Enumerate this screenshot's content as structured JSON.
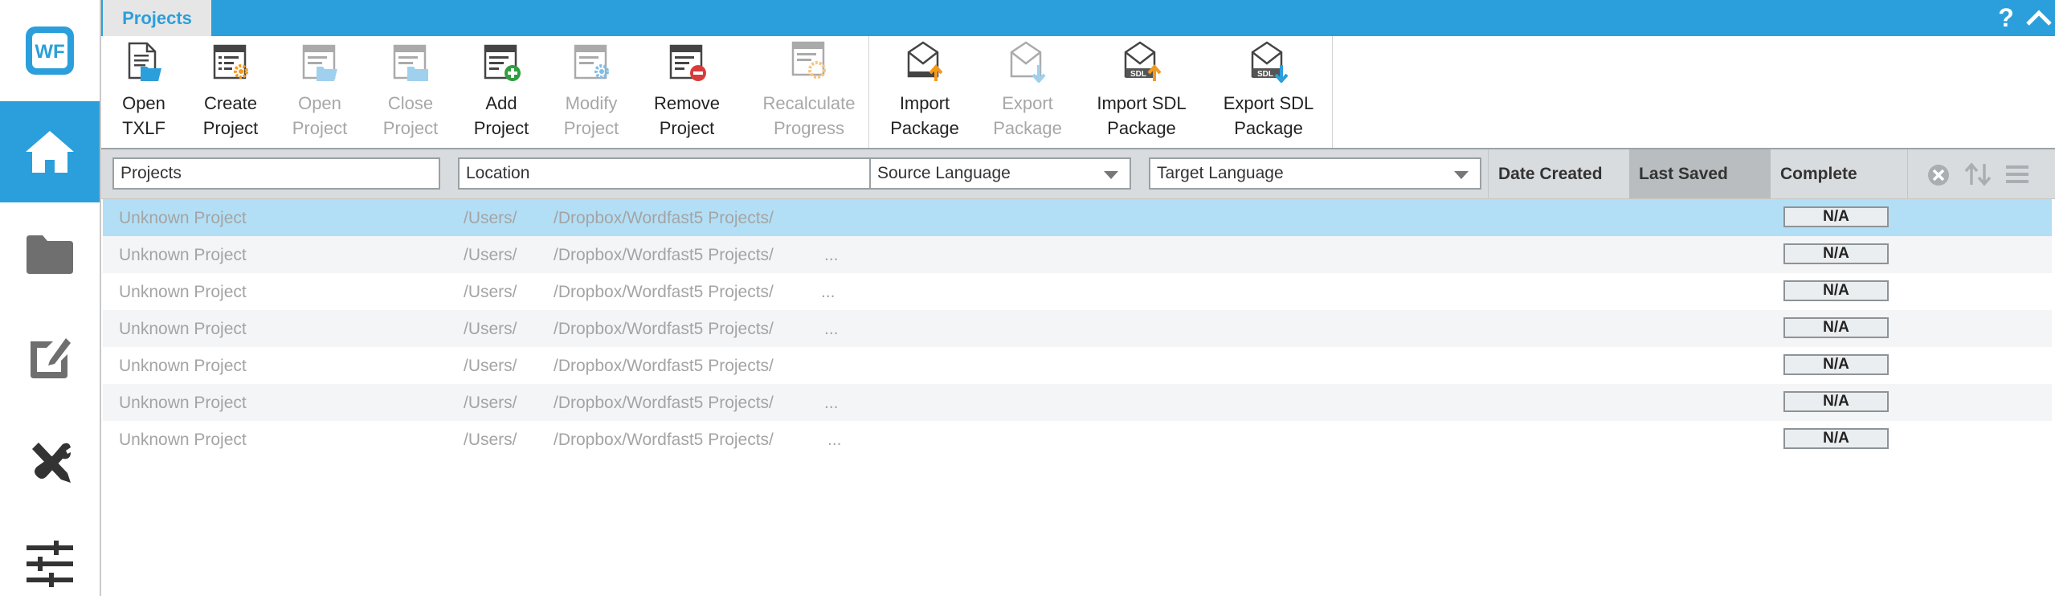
{
  "app": {
    "tab_label": "Projects",
    "help_label": "?",
    "accent_color": "#2b9fdb"
  },
  "sidebar": {
    "items": [
      {
        "name": "wf-logo",
        "label": "WF"
      },
      {
        "name": "home-icon",
        "active": true
      },
      {
        "name": "folder-icon"
      },
      {
        "name": "edit-icon"
      },
      {
        "name": "tools-icon"
      },
      {
        "name": "sliders-icon"
      }
    ]
  },
  "ribbon": {
    "buttons": [
      {
        "id": "open-txlf",
        "label": "Open\nTXLF",
        "enabled": true
      },
      {
        "id": "create-project",
        "label": "Create\nProject",
        "enabled": true
      },
      {
        "id": "open-project",
        "label": "Open\nProject",
        "enabled": false
      },
      {
        "id": "close-project",
        "label": "Close\nProject",
        "enabled": false
      },
      {
        "id": "add-project",
        "label": "Add\nProject",
        "enabled": true
      },
      {
        "id": "modify-project",
        "label": "Modify\nProject",
        "enabled": false
      },
      {
        "id": "remove-project",
        "label": "Remove\nProject",
        "enabled": true
      },
      {
        "id": "recalculate-progress",
        "label": "Recalculate\nProgress",
        "enabled": false
      },
      {
        "id": "import-package",
        "label": "Import\nPackage",
        "enabled": true
      },
      {
        "id": "export-package",
        "label": "Export\nPackage",
        "enabled": false
      },
      {
        "id": "import-sdl-package",
        "label": "Import SDL\nPackage",
        "enabled": true
      },
      {
        "id": "export-sdl-package",
        "label": "Export SDL\nPackage",
        "enabled": true
      }
    ]
  },
  "filters": {
    "projects_placeholder": "Projects",
    "location_placeholder": "Location",
    "source_language": "Source  Language",
    "target_language": "Target  Language"
  },
  "columns": {
    "date_created": "Date Created",
    "last_saved": "Last Saved",
    "complete": "Complete"
  },
  "rows": [
    {
      "name": "Unknown Project",
      "loc_a": "/Users/",
      "loc_b": "/Dropbox/Wordfast5 Projects/",
      "extra": "",
      "complete": "N/A"
    },
    {
      "name": "Unknown Project",
      "loc_a": "/Users/",
      "loc_b": "/Dropbox/Wordfast5 Projects/",
      "extra": "...",
      "complete": "N/A"
    },
    {
      "name": "Unknown Project",
      "loc_a": "/Users/",
      "loc_b": "/Dropbox/Wordfast5 Projects/",
      "extra": "...",
      "complete": "N/A"
    },
    {
      "name": "Unknown Project",
      "loc_a": "/Users/",
      "loc_b": "/Dropbox/Wordfast5 Projects/",
      "extra": "...",
      "complete": "N/A"
    },
    {
      "name": "Unknown Project",
      "loc_a": "/Users/",
      "loc_b": "/Dropbox/Wordfast5 Projects/",
      "extra": "",
      "complete": "N/A"
    },
    {
      "name": "Unknown Project",
      "loc_a": "/Users/",
      "loc_b": "/Dropbox/Wordfast5 Projects/",
      "extra": "...",
      "complete": "N/A"
    },
    {
      "name": "Unknown Project",
      "loc_a": "/Users/",
      "loc_b": "/Dropbox/Wordfast5 Projects/",
      "extra": "...",
      "complete": "N/A"
    }
  ]
}
